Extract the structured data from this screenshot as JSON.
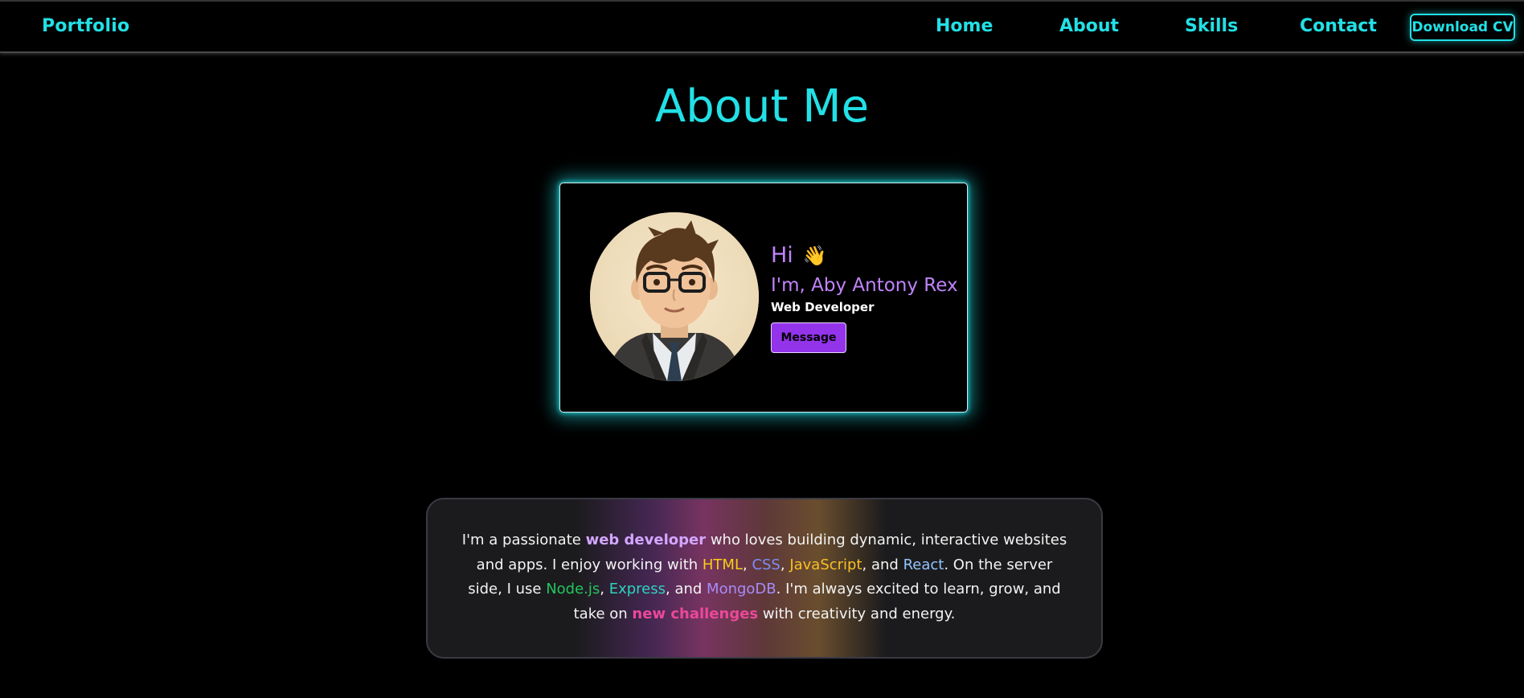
{
  "nav": {
    "brand": "Portfolio",
    "links": [
      "Home",
      "About",
      "Skills",
      "Contact"
    ],
    "cv_button": "Download CV"
  },
  "colors": {
    "accent": "#22e0e6",
    "purple": "#c084fc",
    "button": "#9333ea",
    "background": "#000000"
  },
  "page": {
    "title": "About Me"
  },
  "profile": {
    "greeting": "Hi",
    "wave_icon": "👋",
    "name_line": "I'm, Aby Antony Rex",
    "role": "Web Developer",
    "message_button": "Message",
    "avatar_icon": "cartoon-avatar-icon"
  },
  "bio": {
    "t1": "I'm a passionate ",
    "h1": "web developer",
    "t2": " who loves building dynamic, interactive websites and apps. I enjoy working with ",
    "h_html": "HTML",
    "sep1": ", ",
    "h_css": "CSS",
    "sep2": ", ",
    "h_js": "JavaScript",
    "sep3": ", and ",
    "h_react": "React",
    "t3": ". On the server side, I use ",
    "h_node": "Node.js",
    "sep4": ", ",
    "h_express": "Express",
    "sep5": ", and ",
    "h_mongo": "MongoDB",
    "t4": ". I'm always excited to learn, grow, and take on ",
    "h_new": "new challenges",
    "t5": " with creativity and energy."
  }
}
